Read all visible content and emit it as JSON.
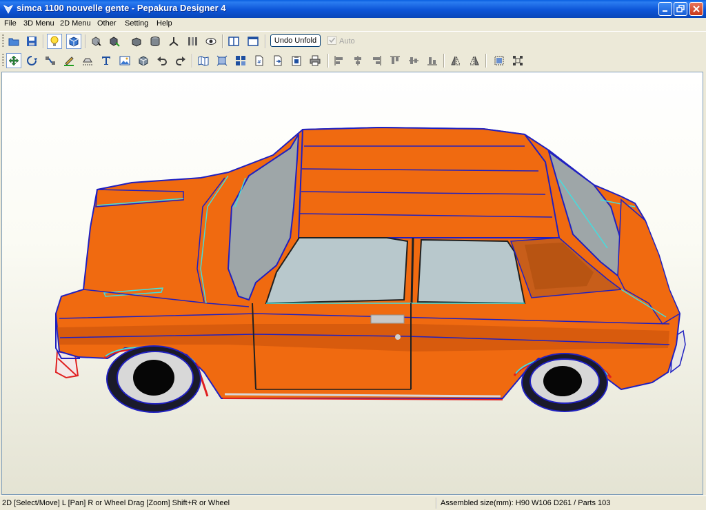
{
  "window": {
    "title": "simca 1100 nouvelle gente - Pepakura Designer 4"
  },
  "menu": [
    "File",
    "3D Menu",
    "2D Menu",
    "Other",
    "Setting",
    "Help"
  ],
  "toolbar1": {
    "undo_unfold_label": "Undo Unfold",
    "auto_label": "Auto",
    "auto_checked": true,
    "auto_enabled": false
  },
  "status": {
    "hint": "2D [Select/Move] L [Pan] R or Wheel Drag [Zoom] Shift+R or Wheel",
    "assembled_size": "Assembled size(mm): H90 W106 D261 / Parts 103"
  },
  "colors": {
    "model_orange": "#f06a10",
    "edge_blue": "#2020c0",
    "edge_cyan": "#40e0e0",
    "glass": "#b8c8cc"
  }
}
